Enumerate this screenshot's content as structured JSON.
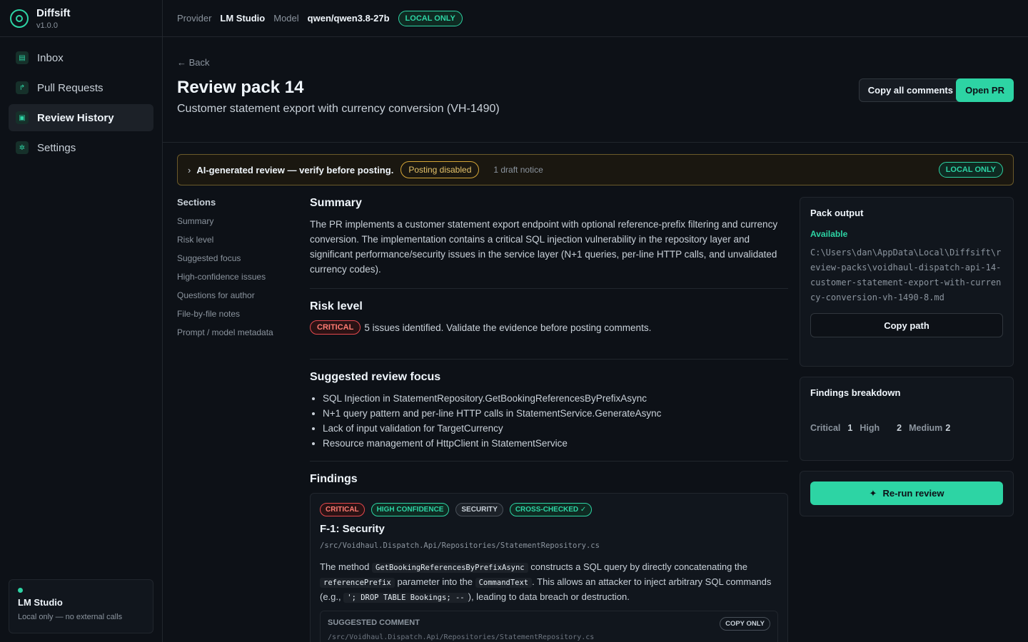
{
  "app": {
    "name": "Diffsift",
    "version": "v1.0.0"
  },
  "nav": [
    {
      "label": "Inbox",
      "icon": "inbox-icon"
    },
    {
      "label": "Pull Requests",
      "icon": "pull-request-icon"
    },
    {
      "label": "Review History",
      "icon": "history-icon",
      "active": true
    },
    {
      "label": "Settings",
      "icon": "gear-icon"
    }
  ],
  "provider_card": {
    "name": "LM Studio",
    "sub": "Local only — no external calls"
  },
  "topbar": {
    "provider_label": "Provider",
    "provider": "LM Studio",
    "model_label": "Model",
    "model": "qwen/qwen3.8-27b",
    "badge": "LOCAL ONLY"
  },
  "header": {
    "back": "← Back",
    "title": "Review pack 14",
    "subtitle": "Customer statement export with currency conversion (VH-1490)",
    "copy_all": "Copy all comments",
    "open_pr": "Open PR"
  },
  "banner": {
    "text": "AI-generated review — verify before posting.",
    "posting": "Posting disabled",
    "notice": "1 draft notice",
    "badge": "LOCAL ONLY"
  },
  "toc": {
    "title": "Sections",
    "items": [
      "Summary",
      "Risk level",
      "Suggested focus",
      "High-confidence issues",
      "Questions for author",
      "File-by-file notes",
      "Prompt / model metadata"
    ]
  },
  "summary": {
    "heading": "Summary",
    "text": "The PR implements a customer statement export endpoint with optional reference-prefix filtering and currency conversion. The implementation contains a critical SQL injection vulnerability in the repository layer and significant performance/security issues in the service layer (N+1 queries, per-line HTTP calls, and unvalidated currency codes)."
  },
  "risk": {
    "heading": "Risk level",
    "badge": "CRITICAL",
    "text": "5 issues identified. Validate the evidence before posting comments."
  },
  "focus": {
    "heading": "Suggested review focus",
    "items": [
      "SQL Injection in StatementRepository.GetBookingReferencesByPrefixAsync",
      "N+1 query pattern and per-line HTTP calls in StatementService.GenerateAsync",
      "Lack of input validation for TargetCurrency",
      "Resource management of HttpClient in StatementService"
    ]
  },
  "findings": {
    "heading": "Findings",
    "tags": [
      "CRITICAL",
      "HIGH CONFIDENCE",
      "SECURITY",
      "CROSS-CHECKED ✓"
    ],
    "title": "F-1: Security",
    "path": "/src/Voidhaul.Dispatch.Api/Repositories/StatementRepository.cs",
    "body": {
      "t1": "The method",
      "c1": "GetBookingReferencesByPrefixAsync",
      "t2": "constructs a SQL query by directly concatenating the",
      "c2": "referencePrefix",
      "t3": "parameter into the",
      "c3": "CommandText",
      "t4": ". This allows an attacker to inject arbitrary SQL commands (e.g.,",
      "c4": "'; DROP TABLE Bookings; --",
      "t5": "), leading to data breach or destruction."
    },
    "suggested_label": "SUGGESTED COMMENT",
    "copy_only": "COPY ONLY",
    "suggested_path": "/src/Voidhaul.Dispatch.Api/Repositories/StatementRepository.cs"
  },
  "pack_output": {
    "title": "Pack output",
    "status": "Available",
    "path": "C:\\Users\\dan\\AppData\\Local\\Diffsift\\review-packs\\voidhaul-dispatch-api-14-customer-statement-export-with-currency-conversion-vh-1490-8.md",
    "copy": "Copy path"
  },
  "breakdown": {
    "title": "Findings breakdown",
    "critical_label": "Critical",
    "critical": "1",
    "high_label": "High",
    "high": "2",
    "medium_label": "Medium",
    "medium": "2"
  },
  "rerun": {
    "label": "Re-run review"
  }
}
